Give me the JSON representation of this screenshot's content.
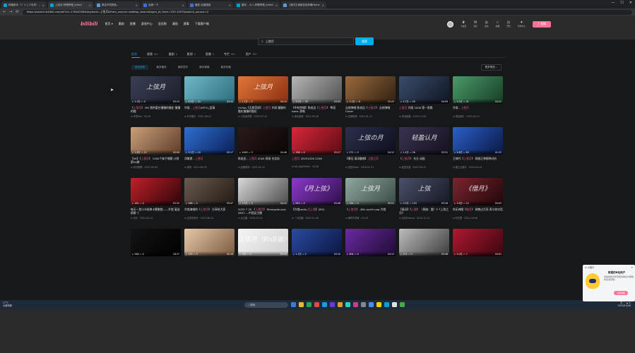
{
  "browser": {
    "tabs": [
      {
        "label": "种植助手 \"ソ ソップ手机\" - bilibili",
        "color": "#00a1d6"
      },
      {
        "label": "上弦月-哔哩哔哩_bilibili",
        "color": "#00a1d6",
        "active": true
      },
      {
        "label": "乘坐不同颜色…",
        "color": "#5a9bd5"
      },
      {
        "label": "百度一下",
        "color": "#3c6fd8"
      },
      {
        "label": "播放-百度搜索",
        "color": "#3c6fd8"
      },
      {
        "label": "星际 - 小八-哔哩哔哩_bilibili",
        "color": "#00a1d6"
      },
      {
        "label": "【某天】·我就告诉你嘛Home",
        "color": "#5a9bd5"
      }
    ],
    "window_controls": [
      "—",
      "☐",
      "✕"
    ],
    "nav": [
      "←",
      "→",
      "⟳"
    ],
    "url": "https://search.bilibili.com/all?vt=17640256&keyword=上弦月&from_source=webtop_search&spm_id_from=333.1007&search_source=2"
  },
  "header": {
    "logo": "bilibili",
    "nav": [
      "首页 ▾",
      "番剧",
      "直播",
      "游戏中心",
      "会员购",
      "漫画",
      "赛事",
      "下载客户端"
    ],
    "right_icons": [
      {
        "icon": "crown-icon",
        "glyph": "♛",
        "label": "大会员"
      },
      {
        "icon": "message-icon",
        "glyph": "✉",
        "label": "消息"
      },
      {
        "icon": "dynamic-icon",
        "glyph": "◎",
        "label": "动态"
      },
      {
        "icon": "star-icon",
        "glyph": "☆",
        "label": "收藏"
      },
      {
        "icon": "history-icon",
        "glyph": "◷",
        "label": "历史"
      },
      {
        "icon": "bulb-icon",
        "glyph": "✦",
        "label": "创作中心"
      }
    ],
    "upload": "⇪ 投稿"
  },
  "search": {
    "value": "上弦月",
    "button": "搜索"
  },
  "type_tabs": [
    {
      "label": "综合",
      "count": "",
      "active": true
    },
    {
      "label": "视频",
      "count": "99+"
    },
    {
      "label": "番剧",
      "count": "0"
    },
    {
      "label": "影视",
      "count": "0"
    },
    {
      "label": "直播",
      "count": "5"
    },
    {
      "label": "专栏",
      "count": "99+"
    },
    {
      "label": "用户",
      "count": "99+"
    }
  ],
  "sort": {
    "chips": [
      "综合排序",
      "最多播放",
      "最新发布",
      "最多弹幕",
      "最多收藏"
    ],
    "more": "更多筛选 ⌄"
  },
  "videos": [
    {
      "thumb_text": "上弦月",
      "bg": "linear-gradient(135deg,#3a3f55,#1c1e2a)",
      "plays": "1.2万",
      "comments": "0",
      "dur": "03:13",
      "title_pre": "《",
      "title_hl": "上弦月",
      "title_post": "》 MV 我的爱在慢慢的融化 慢慢的融",
      "up": "许嵩Vae · 05-26"
    },
    {
      "thumb_text": "",
      "bg": "linear-gradient(135deg,#6fb7c9,#2c6d7a)",
      "plays": "8.9万",
      "comments": "24",
      "dur": "04:34",
      "title_pre": "许嵩 - ",
      "title_hl": "上弦月",
      "title_post": "(MTV)_超清",
      "up": "时光唱片 · 2021-08-21"
    },
    {
      "thumb_text": "上弦月",
      "bg": "linear-gradient(135deg,#e0773a,#8a2e12)",
      "plays": "1.1万",
      "comments": "2",
      "dur": "04:14",
      "title_pre": "Hi-Res【无损音质】",
      "title_hl": "上弦月",
      "title_post": " 许嵩 慢慢的融化慢慢的融化",
      "up": "小耳朵听歌 · 2024-07-15"
    },
    {
      "thumb_text": "",
      "bg": "linear-gradient(135deg,#b5b5b5,#4f4f4f)",
      "plays": "6.0万",
      "comments": "30",
      "dur": "03:55",
      "title_pre": "【中秋特辑】陈奕迅《",
      "title_hl": "上弦月",
      "title_post": "》 粤语 Isaac 漂唱",
      "up": "音乐星球 · 2023-09-28"
    },
    {
      "thumb_text": "",
      "bg": "linear-gradient(135deg,#9a6a3c,#2e1f12)",
      "plays": "2.5万",
      "comments": "8",
      "dur": "03:22",
      "title_pre": "吉他弹唱 陈奕迅《",
      "title_hl": "上弦月",
      "title_post": "》 吉他弹唱 Cover",
      "up": "吉他阿泽 · 2022-01-11"
    },
    {
      "thumb_text": "",
      "bg": "linear-gradient(135deg,#3b4c6a,#0f1524)",
      "plays": "4.7万",
      "comments": "55",
      "dur": "04:09",
      "title_pre": "",
      "title_hl": "上弦月",
      "title_post": " 许嵩 2008 第一首歌",
      "up": "怀旧经典 · 2019-12-06"
    },
    {
      "thumb_text": "",
      "bg": "linear-gradient(135deg,#4a9b6a,#173d25)",
      "plays": "9.3万",
      "comments": "41",
      "dur": "04:22",
      "title_pre": "许嵩 - ",
      "title_hl": "上弦月",
      "title_post": "",
      "up": "周边音乐 · 2023-04-11"
    },
    {
      "thumb_text": "",
      "bg": "linear-gradient(135deg,#c9a07a,#5e3b2a)",
      "plays": "1.8万",
      "comments": "12",
      "dur": "03:59",
      "title_pre": "【5K】《",
      "title_hl": "上弦月",
      "title_post": "》 1000个妹子唱歌 计划第54期",
      "up": "欢乐唱歌 · 2023-09-09"
    },
    {
      "thumb_text": "",
      "bg": "linear-gradient(135deg,#2e6fd0,#0b1f57)",
      "plays": "3.1万",
      "comments": "19",
      "dur": "05:17",
      "title_pre": "邓紫棋 - ",
      "title_hl": "上弦月",
      "title_post": "",
      "up": "现场 · 2021-08-09"
    },
    {
      "thumb_text": "",
      "bg": "linear-gradient(135deg,#2a1a1a,#0a0505)",
      "plays": "1449",
      "comments": "3",
      "dur": "04:46",
      "title_pre": "陈奕迅 - ",
      "title_hl": "上弦月",
      "title_post": " 2000 现场 台北站",
      "up": "经典现场 · 2021-02-21"
    },
    {
      "thumb_text": "",
      "bg": "linear-gradient(135deg,#d6283a,#5c0c14)",
      "plays": "298",
      "comments": "0",
      "dur": "03:27",
      "title_pre": "",
      "title_hl": "上弦月",
      "title_post": " 20251026 2206",
      "up": "bili_bghhkeelr · 10-26"
    },
    {
      "thumb_text": "上弦の月",
      "bg": "linear-gradient(135deg,#2b2f4a,#0d0f1e)",
      "plays": "271",
      "comments": "0",
      "dur": "04:12",
      "title_pre": "【景征 填词翻唱】",
      "title_hl": "上弦之月",
      "title_post": "",
      "up": "景征Elista · 2018-01-21"
    },
    {
      "thumb_text": "轻盈认月",
      "bg": "linear-gradient(135deg,#3a3350,#15111f)",
      "plays": "1.4万",
      "comments": "26",
      "dur": "03:31",
      "title_pre": "《",
      "title_hl": "上弦月",
      "title_post": "》 东方 动画",
      "up": "星空动漫 · 2023-09-12"
    },
    {
      "thumb_text": "",
      "bg": "linear-gradient(135deg,#2b5fc9,#0b1844)",
      "plays": "9.6万",
      "comments": "63",
      "dur": "01:22",
      "title_pre": "王律代《",
      "title_hl": "上弦月",
      "title_post": "》 网络正弹钢琴对抗",
      "up": "唐之云音乐 · 2024-04-14"
    },
    {
      "thumb_text": "",
      "bg": "linear-gradient(135deg,#c0202a,#2d0508)",
      "plays": "181",
      "comments": "0",
      "dur": "03:32",
      "title_pre": "每天一首小众经典卡蒙剿锁——许嵩",
      "title_hl": "",
      "title_post": " 宴送欧歌《",
      "up": "乐乐 · 2022-05-12"
    },
    {
      "thumb_text": "",
      "bg": "linear-gradient(135deg,#6a5a4e,#221a14)",
      "plays": "268",
      "comments": "0",
      "dur": "03:47",
      "title_pre": "许嵩演唱的《",
      "title_hl": "上弦月",
      "title_post": "》 分享给大家",
      "up": "正在听的乐 · 2023-06-14"
    },
    {
      "thumb_text": "",
      "bg": "linear-gradient(135deg,#d8d8d8,#4a4a4a)",
      "plays": "3.3万",
      "comments": "5",
      "dur": "04:22",
      "title_pre": "2025 7 20 《",
      "title_hl": "上弦月",
      "title_post": "》 Shangxianyue 0837 ---中国女主播",
      "up": "女主播 · 2025-07-21"
    },
    {
      "thumb_text": "《月上弦》",
      "bg": "linear-gradient(135deg,#8c3ac9,#2e0f4a)",
      "plays": "815",
      "comments": "0",
      "dur": "03:46",
      "title_pre": "【许嵩radio-",
      "title_hl": "月上弦",
      "title_post": "】(MV)",
      "up": "一口白糖 · 2023-11-08"
    },
    {
      "thumb_text": "上弦月",
      "bg": "linear-gradient(135deg,#8fa8a0,#3a4a45)",
      "plays": "294",
      "comments": "0",
      "dur": "05:51",
      "title_pre": "《",
      "title_hl": "上弦月",
      "title_post": "》 -80s synth pop 许嵩",
      "up": "弹琴不重置 · 02-29"
    },
    {
      "thumb_text": "上弦",
      "bg": "linear-gradient(135deg,#4a5068,#151824)",
      "plays": "3.2万",
      "comments": "125",
      "dur": "03:16",
      "title_pre": "【填词】《",
      "title_hl": "上弦",
      "title_post": "》 （原曲：霞）P《上弦之月》",
      "up": "月光Eleanor · 2019-12-21"
    },
    {
      "thumb_text": "《借月》",
      "bg": "linear-gradient(135deg,#7a2530,#200609)",
      "plays": "3.6万",
      "comments": "12",
      "dur": "04:03",
      "title_pre": "你无神眼《",
      "title_hl": "借月",
      "title_post": "》 致敬过月亮 再与你对话",
      "up": "时光里 · 2021-09-08"
    },
    {
      "thumb_text": "",
      "bg": "linear-gradient(135deg,#141414,#000000)",
      "plays": "548",
      "comments": "0",
      "dur": "18:37",
      "title_pre": "",
      "title_hl": "",
      "title_post": "",
      "up": ""
    },
    {
      "thumb_text": "",
      "bg": "linear-gradient(135deg,#e6c8a8,#7a5a40)",
      "plays": "129",
      "comments": "0",
      "dur": "00:18",
      "title_pre": "",
      "title_hl": "",
      "title_post": "",
      "up": ""
    },
    {
      "thumb_text": "上弦月（RnB版）",
      "bg": "linear-gradient(135deg,#f4f4f4,#cfcfcf)",
      "plays": "300",
      "comments": "0",
      "dur": "03:55",
      "title_pre": "",
      "title_hl": "",
      "title_post": "",
      "up": ""
    },
    {
      "thumb_text": "",
      "bg": "linear-gradient(135deg,#2a4aa0,#0b1640)",
      "plays": "1.1万",
      "comments": "2",
      "dur": "03:10",
      "title_pre": "",
      "title_hl": "",
      "title_post": "",
      "up": ""
    },
    {
      "thumb_text": "",
      "bg": "linear-gradient(135deg,#6a2aa0,#1e0b35)",
      "plays": "804",
      "comments": "0",
      "dur": "04:12",
      "title_pre": "",
      "title_hl": "",
      "title_post": "",
      "up": ""
    },
    {
      "thumb_text": "",
      "bg": "linear-gradient(135deg,#bcbcbc,#3c3c3c)",
      "plays": "231",
      "comments": "0",
      "dur": "03:48",
      "title_pre": "",
      "title_hl": "",
      "title_post": "",
      "up": ""
    },
    {
      "thumb_text": "",
      "bg": "linear-gradient(135deg,#b01830,#3a0610)",
      "plays": "2.0万",
      "comments": "7",
      "dur": "04:01",
      "title_pre": "",
      "title_hl": "",
      "title_post": "",
      "up": ""
    }
  ],
  "taskbar": {
    "left_top": "17°C",
    "left_bottom": "大部晴朗",
    "search_placeholder": "⌕ 搜索",
    "right_top": "中 ⌃ ☁ ⊙",
    "right_bottom": "2025/10/26",
    "icon_colors": [
      "#3a7bd5",
      "#f2b632",
      "#2aa44a",
      "#e34c3a",
      "#1b9be0",
      "#6a3ae0",
      "#e39a2a",
      "#2ad0c0",
      "#d03a8a",
      "#888888",
      "#4a90e2",
      "#ffcc00",
      "#00a1d6",
      "#e0e0e0",
      "#44aa44"
    ]
  },
  "popup": {
    "header": "⊛ 小窗口",
    "close": "✕",
    "title": "数据的B站用户",
    "text": "偷偷地告诉你有很多精彩内容等你来发现哦~",
    "button": "立即领取"
  }
}
